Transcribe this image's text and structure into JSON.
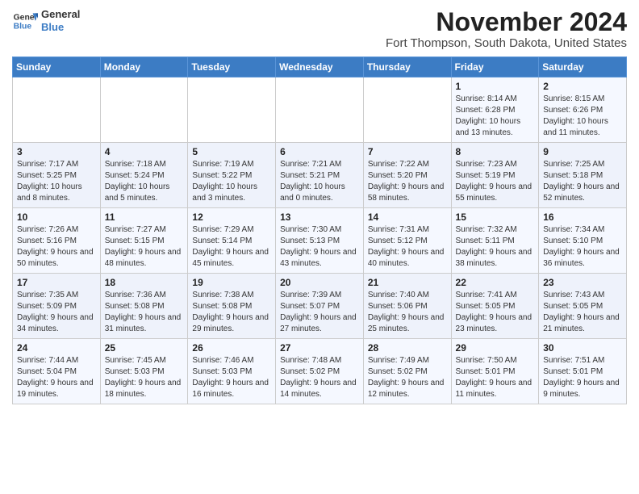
{
  "header": {
    "logo_line1": "General",
    "logo_line2": "Blue",
    "month": "November 2024",
    "location": "Fort Thompson, South Dakota, United States"
  },
  "days_of_week": [
    "Sunday",
    "Monday",
    "Tuesday",
    "Wednesday",
    "Thursday",
    "Friday",
    "Saturday"
  ],
  "weeks": [
    [
      {
        "day": "",
        "info": ""
      },
      {
        "day": "",
        "info": ""
      },
      {
        "day": "",
        "info": ""
      },
      {
        "day": "",
        "info": ""
      },
      {
        "day": "",
        "info": ""
      },
      {
        "day": "1",
        "info": "Sunrise: 8:14 AM\nSunset: 6:28 PM\nDaylight: 10 hours and 13 minutes."
      },
      {
        "day": "2",
        "info": "Sunrise: 8:15 AM\nSunset: 6:26 PM\nDaylight: 10 hours and 11 minutes."
      }
    ],
    [
      {
        "day": "3",
        "info": "Sunrise: 7:17 AM\nSunset: 5:25 PM\nDaylight: 10 hours and 8 minutes."
      },
      {
        "day": "4",
        "info": "Sunrise: 7:18 AM\nSunset: 5:24 PM\nDaylight: 10 hours and 5 minutes."
      },
      {
        "day": "5",
        "info": "Sunrise: 7:19 AM\nSunset: 5:22 PM\nDaylight: 10 hours and 3 minutes."
      },
      {
        "day": "6",
        "info": "Sunrise: 7:21 AM\nSunset: 5:21 PM\nDaylight: 10 hours and 0 minutes."
      },
      {
        "day": "7",
        "info": "Sunrise: 7:22 AM\nSunset: 5:20 PM\nDaylight: 9 hours and 58 minutes."
      },
      {
        "day": "8",
        "info": "Sunrise: 7:23 AM\nSunset: 5:19 PM\nDaylight: 9 hours and 55 minutes."
      },
      {
        "day": "9",
        "info": "Sunrise: 7:25 AM\nSunset: 5:18 PM\nDaylight: 9 hours and 52 minutes."
      }
    ],
    [
      {
        "day": "10",
        "info": "Sunrise: 7:26 AM\nSunset: 5:16 PM\nDaylight: 9 hours and 50 minutes."
      },
      {
        "day": "11",
        "info": "Sunrise: 7:27 AM\nSunset: 5:15 PM\nDaylight: 9 hours and 48 minutes."
      },
      {
        "day": "12",
        "info": "Sunrise: 7:29 AM\nSunset: 5:14 PM\nDaylight: 9 hours and 45 minutes."
      },
      {
        "day": "13",
        "info": "Sunrise: 7:30 AM\nSunset: 5:13 PM\nDaylight: 9 hours and 43 minutes."
      },
      {
        "day": "14",
        "info": "Sunrise: 7:31 AM\nSunset: 5:12 PM\nDaylight: 9 hours and 40 minutes."
      },
      {
        "day": "15",
        "info": "Sunrise: 7:32 AM\nSunset: 5:11 PM\nDaylight: 9 hours and 38 minutes."
      },
      {
        "day": "16",
        "info": "Sunrise: 7:34 AM\nSunset: 5:10 PM\nDaylight: 9 hours and 36 minutes."
      }
    ],
    [
      {
        "day": "17",
        "info": "Sunrise: 7:35 AM\nSunset: 5:09 PM\nDaylight: 9 hours and 34 minutes."
      },
      {
        "day": "18",
        "info": "Sunrise: 7:36 AM\nSunset: 5:08 PM\nDaylight: 9 hours and 31 minutes."
      },
      {
        "day": "19",
        "info": "Sunrise: 7:38 AM\nSunset: 5:08 PM\nDaylight: 9 hours and 29 minutes."
      },
      {
        "day": "20",
        "info": "Sunrise: 7:39 AM\nSunset: 5:07 PM\nDaylight: 9 hours and 27 minutes."
      },
      {
        "day": "21",
        "info": "Sunrise: 7:40 AM\nSunset: 5:06 PM\nDaylight: 9 hours and 25 minutes."
      },
      {
        "day": "22",
        "info": "Sunrise: 7:41 AM\nSunset: 5:05 PM\nDaylight: 9 hours and 23 minutes."
      },
      {
        "day": "23",
        "info": "Sunrise: 7:43 AM\nSunset: 5:05 PM\nDaylight: 9 hours and 21 minutes."
      }
    ],
    [
      {
        "day": "24",
        "info": "Sunrise: 7:44 AM\nSunset: 5:04 PM\nDaylight: 9 hours and 19 minutes."
      },
      {
        "day": "25",
        "info": "Sunrise: 7:45 AM\nSunset: 5:03 PM\nDaylight: 9 hours and 18 minutes."
      },
      {
        "day": "26",
        "info": "Sunrise: 7:46 AM\nSunset: 5:03 PM\nDaylight: 9 hours and 16 minutes."
      },
      {
        "day": "27",
        "info": "Sunrise: 7:48 AM\nSunset: 5:02 PM\nDaylight: 9 hours and 14 minutes."
      },
      {
        "day": "28",
        "info": "Sunrise: 7:49 AM\nSunset: 5:02 PM\nDaylight: 9 hours and 12 minutes."
      },
      {
        "day": "29",
        "info": "Sunrise: 7:50 AM\nSunset: 5:01 PM\nDaylight: 9 hours and 11 minutes."
      },
      {
        "day": "30",
        "info": "Sunrise: 7:51 AM\nSunset: 5:01 PM\nDaylight: 9 hours and 9 minutes."
      }
    ]
  ]
}
